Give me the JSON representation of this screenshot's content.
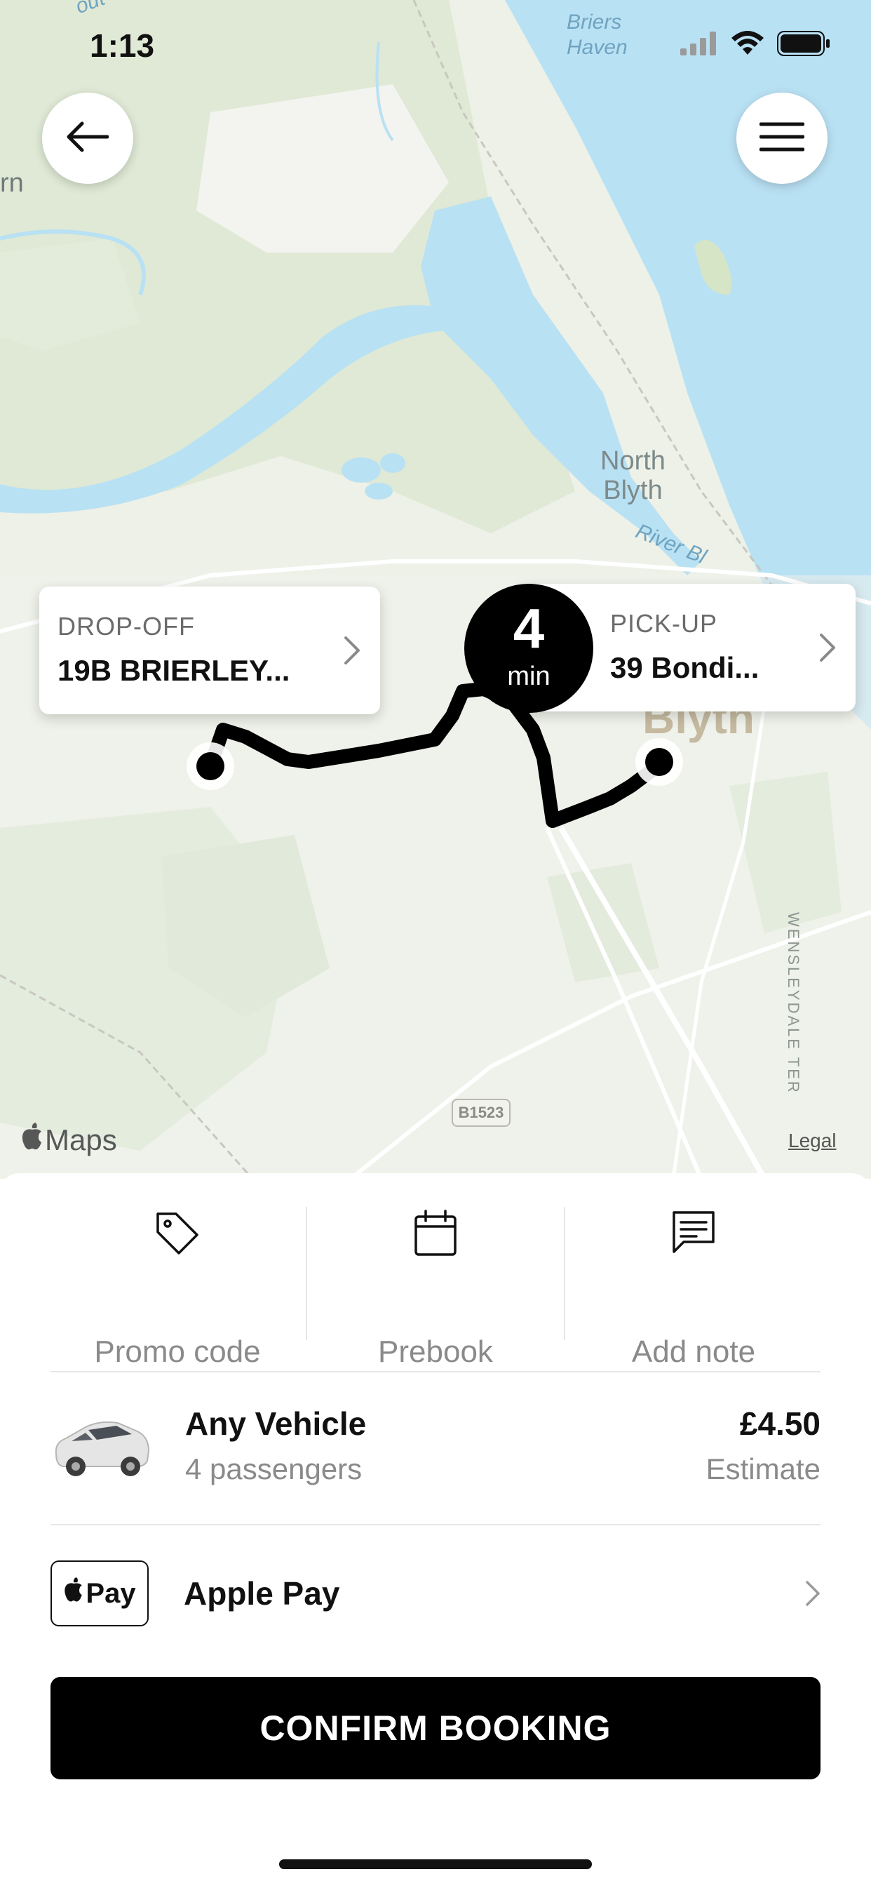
{
  "status_bar": {
    "time": "1:13"
  },
  "map": {
    "place_labels": {
      "north_blyth": "North\nBlyth",
      "briers_haven": "Briers\nHaven",
      "river_blyth": "River Bl",
      "town": "Blyth",
      "corner_top": "out",
      "corner_left": "rn"
    },
    "road_shield": "B1523",
    "street_label": "WENSLEYDALE TER",
    "credit": "Maps",
    "legal": "Legal",
    "dropoff": {
      "caption": "DROP-OFF",
      "address": "19B BRIERLEY..."
    },
    "pickup": {
      "caption": "PICK-UP",
      "address": "39 Bondi..."
    },
    "eta": {
      "value": "4",
      "unit": "min"
    },
    "colors": {
      "land": "#eef1e7",
      "water": "#b9e1f4",
      "park": "#d7e6cd",
      "route": "#000000"
    }
  },
  "actions": [
    {
      "label": "Promo code",
      "icon": "tag-icon"
    },
    {
      "label": "Prebook",
      "icon": "calendar-icon"
    },
    {
      "label": "Add note",
      "icon": "note-icon"
    }
  ],
  "vehicle": {
    "name": "Any Vehicle",
    "capacity": "4 passengers",
    "price": "£4.50",
    "price_note": "Estimate"
  },
  "payment": {
    "badge": "Pay",
    "label": "Apple Pay"
  },
  "confirm_label": "CONFIRM BOOKING"
}
